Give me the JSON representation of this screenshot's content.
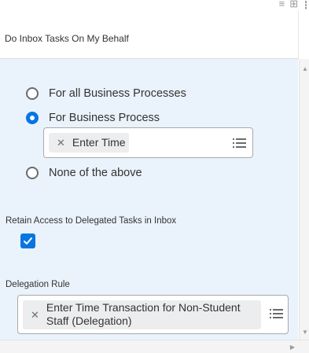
{
  "header": {
    "title": "Do Inbox Tasks On My Behalf"
  },
  "radio_group": {
    "options": [
      {
        "label": "For all Business Processes",
        "selected": false
      },
      {
        "label": "For Business Process",
        "selected": true
      },
      {
        "label": "None of the above",
        "selected": false
      }
    ],
    "business_process_prompt": {
      "value": "Enter Time"
    }
  },
  "retain_access": {
    "label": "Retain Access to Delegated Tasks in Inbox",
    "checked": true
  },
  "delegation_rule": {
    "label": "Delegation Rule",
    "value_line1": "Enter Time Transaction for Non-Student",
    "value_line2": "Staff (Delegation)"
  },
  "colors": {
    "accent": "#0875e1",
    "panel_background": "#eaf3fb",
    "pill_background": "#ecedee"
  },
  "icons": {
    "remove": "close-icon",
    "prompt_list": "list-icon",
    "top_toolbar": [
      "filter-icon",
      "grid-icon",
      "column-icon"
    ]
  }
}
